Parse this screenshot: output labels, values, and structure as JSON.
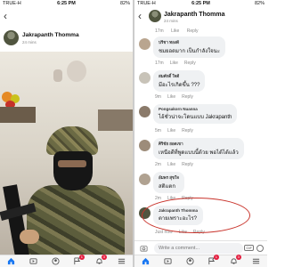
{
  "left": {
    "status": {
      "carrier": "TRUE-H",
      "time": "6:25 PM",
      "battery": "82%"
    },
    "header": {
      "title": "Jakrapanth Thomma",
      "subtitle": "24 mins"
    },
    "post": {
      "author": "Jakrapanth Thomma",
      "time": "24 mins",
      "photo": "soldier-with-rifle-photo"
    }
  },
  "right": {
    "status": {
      "carrier": "TRUE-H",
      "time": "6:25 PM",
      "battery": "82%"
    },
    "header": {
      "title": "Jakrapanth Thomma",
      "subtitle": "24 mins"
    },
    "top_meta": {
      "time": "17m",
      "like": "Like",
      "reply": "Reply"
    },
    "comments": [
      {
        "name": "ปรีชา ทองดี",
        "text": "ชมยอดมาก เป็นกำลังใจนะ",
        "time": "17m",
        "like": "Like",
        "reply": "Reply",
        "avatar_color": "#b9a58f"
      },
      {
        "name": "สมศักดิ์ ใจดี",
        "text": "มีอะไรเกิดขึ้น ???",
        "time": "9m",
        "like": "Like",
        "reply": "Reply",
        "avatar_color": "#c8c3b8"
      },
      {
        "name": "Pongsakorn Nuanna",
        "text": "ไอ้ชั่วน่าจะโดนแบบ Jakrapanth",
        "time": "5m",
        "like": "Like",
        "reply": "Reply",
        "avatar_color": "#8a7a6a"
      },
      {
        "name": "ศิริชัย ยอดเขา",
        "text": "เหนือดีที่พูดแบบนี้ด้วย พอได้ได้แล้ว",
        "time": "2m",
        "like": "Like",
        "reply": "Reply",
        "avatar_color": "#9d8c7a"
      },
      {
        "name": "อัมพร สุขใจ",
        "text": "สติแตก",
        "time": "2m",
        "like": "Like",
        "reply": "Reply",
        "avatar_color": "#b0a291"
      },
      {
        "name": "Jakrapanth Thomma",
        "text": "ตายเพราะอะไร?",
        "time": "Just now",
        "like": "Like",
        "reply": "Reply",
        "avatar_color": "#50553f"
      }
    ],
    "composer": {
      "placeholder": "Write a comment...",
      "gif": "GIF"
    }
  },
  "tabbar": {
    "items": [
      "home-icon",
      "video-icon",
      "profile-icon",
      "flag-icon",
      "notification-icon",
      "menu-icon"
    ],
    "badges": {
      "profile": "1",
      "notification": "3"
    }
  }
}
